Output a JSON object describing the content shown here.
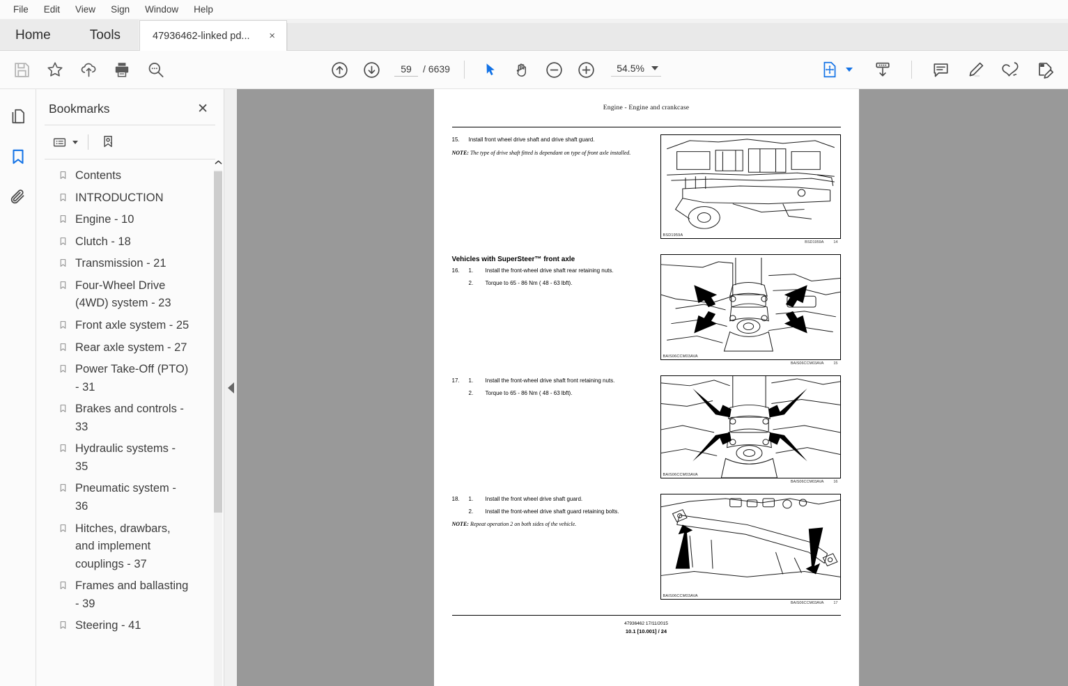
{
  "menubar": {
    "items": [
      "File",
      "Edit",
      "View",
      "Sign",
      "Window",
      "Help"
    ]
  },
  "tabbar": {
    "home_label": "Home",
    "tools_label": "Tools",
    "doc_tab_label": "47936462-linked pd...",
    "doc_tab_close": "×"
  },
  "toolbar": {
    "left_icons": [
      "save-icon",
      "star-icon",
      "cloud-upload-icon",
      "print-icon",
      "zoom-search-icon"
    ],
    "prev_page_icon": "arrow-up-circle-icon",
    "next_page_icon": "arrow-down-circle-icon",
    "page_current": "59",
    "page_total": "/ 6639",
    "select_tool_icon": "cursor-arrow-icon",
    "hand_tool_icon": "hand-icon",
    "zoom_out_icon": "minus-circle-icon",
    "zoom_in_icon": "plus-circle-icon",
    "zoom_value": "54.5%",
    "fit_page_icon": "fit-page-icon",
    "download_icon": "download-icon",
    "comment_icon": "comment-icon",
    "highlight_icon": "highlight-pen-icon",
    "sign_icon": "sign-pen-icon",
    "fill_sign_icon": "fill-and-sign-icon",
    "accent_color": "#1473e6"
  },
  "rail": {
    "items": [
      {
        "name": "page-thumbnails-icon",
        "active": false
      },
      {
        "name": "bookmarks-icon",
        "active": true
      },
      {
        "name": "attachments-icon",
        "active": false
      }
    ]
  },
  "panel": {
    "title": "Bookmarks",
    "close_label": "✕",
    "options_icon": "list-options-icon",
    "new_bookmark_icon": "new-bookmark-icon",
    "bookmarks": [
      "Contents",
      "INTRODUCTION",
      "Engine - 10",
      "Clutch - 18",
      "Transmission - 21",
      "Four-Wheel Drive (4WD) system - 23",
      "Front axle system - 25",
      "Rear axle system - 27",
      "Power Take-Off (PTO) - 31",
      "Brakes and controls - 33",
      "Hydraulic systems - 35",
      "Pneumatic system - 36",
      "Hitches, drawbars, and implement couplings - 37",
      "Frames and ballasting - 39",
      "Steering - 41"
    ]
  },
  "document": {
    "header": "Engine - Engine and crankcase",
    "blocks": [
      {
        "number": "15.",
        "text": "Install front wheel drive shaft and drive shaft guard.",
        "note_label": "NOTE:",
        "note": " The type of drive shaft fitted is dependant on type of front axle installed.",
        "fig_code": "BSD1959A",
        "fig_caption_code": "BSD1959A",
        "fig_caption_num": "14"
      },
      {
        "section_heading": "Vehicles with SuperSteer™ front axle",
        "number": "16.",
        "sub1_num": "1.",
        "sub1_text": "Install the front-wheel drive shaft rear retaining nuts.",
        "sub2_num": "2.",
        "sub2_text": "Torque to 65 - 86 Nm ( 48 - 63 lbft).",
        "fig_code": "BAIS06CCM03AVA",
        "fig_caption_code": "BAIS06CCM03AVA",
        "fig_caption_num": "15"
      },
      {
        "number": "17.",
        "sub1_num": "1.",
        "sub1_text": "Install the front-wheel drive shaft front retaining nuts.",
        "sub2_num": "2.",
        "sub2_text": "Torque to 65 - 86 Nm ( 48 - 63 lbft).",
        "fig_code": "BAIS06CCM03AVA",
        "fig_caption_code": "BAIS06CCM03AVA",
        "fig_caption_num": "16"
      },
      {
        "number": "18.",
        "sub1_num": "1.",
        "sub1_text": "Install the front wheel drive shaft guard.",
        "sub2_num": "2.",
        "sub2_text": "Install the front-wheel drive shaft guard retaining bolts.",
        "note_label": "NOTE:",
        "note": " Repeat operation 2 on both sides of the vehicle.",
        "fig_code": "BAIS06CCM03AVA",
        "fig_caption_code": "BAIS06CCM03AVA",
        "fig_caption_num": "17"
      }
    ],
    "footer_line1": "47936462 17/11/2015",
    "footer_line2": "10.1 [10.001] / 24"
  }
}
